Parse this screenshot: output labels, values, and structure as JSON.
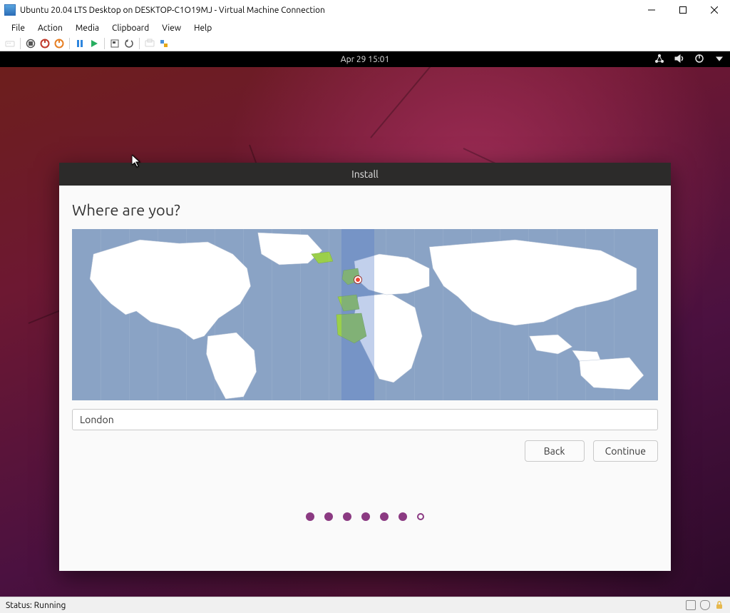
{
  "host_window": {
    "title": "Ubuntu 20.04 LTS Desktop on DESKTOP-C1O19MJ - Virtual Machine Connection",
    "status_label": "Status:",
    "status_value": "Running"
  },
  "host_menu": {
    "file": "File",
    "action": "Action",
    "media": "Media",
    "clipboard": "Clipboard",
    "view": "View",
    "help": "Help"
  },
  "host_toolbar": {
    "ctrl_alt_del": "ctrl-alt-del",
    "turn_off": "turn-off",
    "shut_down": "shut-down",
    "save": "save",
    "pause": "pause",
    "start": "start",
    "reset": "reset",
    "checkpoint": "checkpoint",
    "revert": "revert",
    "enhanced": "enhanced-session",
    "share": "share"
  },
  "guest_bar": {
    "datetime": "Apr 29  15:01"
  },
  "installer": {
    "title": "Install",
    "heading": "Where are you?",
    "timezone_value": "London",
    "back_label": "Back",
    "continue_label": "Continue",
    "progress_total": 7,
    "progress_current": 6
  }
}
